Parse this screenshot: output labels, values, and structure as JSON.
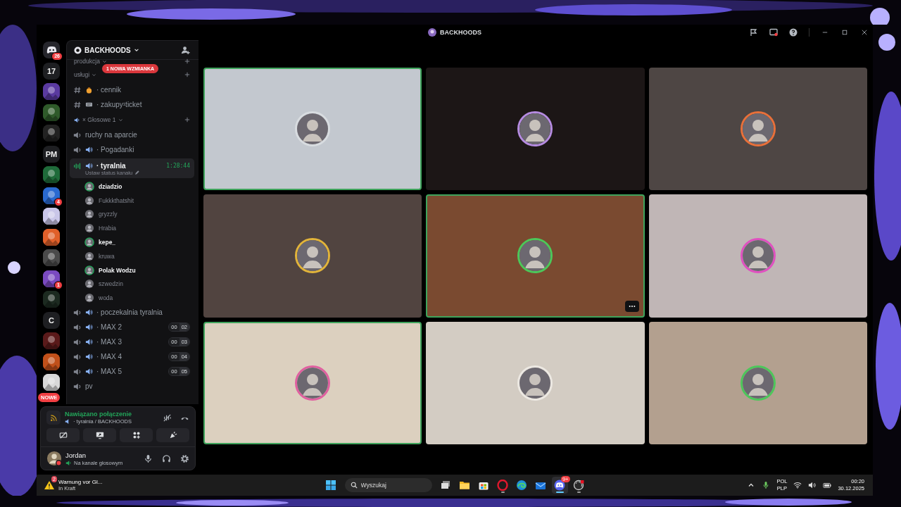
{
  "window": {
    "title": "BACKHOODS"
  },
  "servers": [
    {
      "kind": "home",
      "badge": "26"
    },
    {
      "kind": "text",
      "label": "17"
    },
    {
      "kind": "picture",
      "color": "#5a3aa0"
    },
    {
      "kind": "picture",
      "color": "#2f5a2a"
    },
    {
      "kind": "picture",
      "color": "#222222"
    },
    {
      "kind": "text",
      "label": "PM"
    },
    {
      "kind": "picture",
      "color": "#1f6b3a"
    },
    {
      "kind": "picture",
      "color": "#2a6ad0",
      "badge": "4"
    },
    {
      "kind": "picture",
      "color": "#c9c6e8"
    },
    {
      "kind": "picture",
      "color": "#e0602a"
    },
    {
      "kind": "picture",
      "color": "#4a4a4a"
    },
    {
      "kind": "picture",
      "color": "#7a4ac0",
      "badge": "1"
    },
    {
      "kind": "picture",
      "color": "#1c2a20"
    },
    {
      "kind": "text",
      "label": "C"
    },
    {
      "kind": "picture",
      "color": "#5a1a1a"
    },
    {
      "kind": "picture",
      "color": "#c0501a"
    },
    {
      "kind": "picture",
      "color": "#d8d8d8"
    }
  ],
  "new_pill": "NOWE",
  "server": {
    "name": "BACKHOODS",
    "mention_pill": "1 NOWA WZMIANKA"
  },
  "channels": [
    {
      "kind": "category",
      "label": "produkcja",
      "add": true
    },
    {
      "kind": "category",
      "label": "usługi",
      "add": true
    },
    {
      "kind": "text",
      "label": "· cennik",
      "emoji": {
        "kind": "bag"
      }
    },
    {
      "kind": "text",
      "label": "· zakupy¹ticket",
      "emoji": {
        "kind": "ticket"
      }
    },
    {
      "kind": "voice_category",
      "label": "× Głosowe 1",
      "add": true
    },
    {
      "kind": "voice",
      "label": "ruchy na aparcie",
      "emoji": false,
      "selected": false
    },
    {
      "kind": "voice",
      "label": "· Pogadanki",
      "emoji": true,
      "selected": false
    },
    {
      "kind": "voice",
      "label": "· tyralnia",
      "emoji": true,
      "selected": true,
      "timer": "1:28:44",
      "status": "Ustaw status kanału",
      "members": [
        {
          "name": "dziadzio",
          "speaking": true
        },
        {
          "name": "Fukkkthatshit",
          "speaking": false
        },
        {
          "name": "gryzzly",
          "speaking": false
        },
        {
          "name": "Hrabia",
          "speaking": false
        },
        {
          "name": "kepe_",
          "speaking": true
        },
        {
          "name": "kruwa",
          "speaking": false
        },
        {
          "name": "Polak Wodzu",
          "speaking": true
        },
        {
          "name": "szwedzin",
          "speaking": false
        },
        {
          "name": "woda",
          "speaking": false
        }
      ]
    },
    {
      "kind": "voice",
      "label": "· poczekalnia tyralnia",
      "emoji": true,
      "selected": false
    },
    {
      "kind": "voice",
      "label": "· MAX 2",
      "emoji": true,
      "selected": false,
      "count": "00",
      "limit": "02"
    },
    {
      "kind": "voice",
      "label": "· MAX 3",
      "emoji": true,
      "selected": false,
      "count": "00",
      "limit": "03"
    },
    {
      "kind": "voice",
      "label": "· MAX 4",
      "emoji": true,
      "selected": false,
      "count": "00",
      "limit": "04"
    },
    {
      "kind": "voice",
      "label": "· MAX 5",
      "emoji": true,
      "selected": false,
      "count": "00",
      "limit": "05"
    },
    {
      "kind": "voice",
      "label": "pv",
      "emoji": false,
      "selected": false
    }
  ],
  "connection": {
    "status": "Nawiązano połączenie",
    "channel": "· tyralnia / BACKHOODS"
  },
  "user": {
    "name": "Jordan",
    "status": "Na kanale głosowym"
  },
  "videos": [
    {
      "color": "#c3c8cf",
      "avatar": {
        "color": "#d8dce0"
      },
      "speaking": true,
      "menu": false
    },
    {
      "color": "#1c1616",
      "avatar": {
        "color": "#b58be0"
      },
      "speaking": false,
      "menu": false
    },
    {
      "color": "#4e4644",
      "avatar": {
        "color": "#e8703a"
      },
      "speaking": false,
      "menu": false
    },
    {
      "color": "#514440",
      "avatar": {
        "color": "#e2b43a"
      },
      "speaking": false,
      "menu": false
    },
    {
      "color": "#7a4a30",
      "avatar": {
        "color": "#4cc75a"
      },
      "speaking": true,
      "menu": true
    },
    {
      "color": "#c0b6b6",
      "avatar": {
        "color": "#e050c0"
      },
      "speaking": false,
      "menu": false
    },
    {
      "color": "#dcd0bf",
      "avatar": {
        "color": "#e060a0"
      },
      "speaking": true,
      "menu": false
    },
    {
      "color": "#d3ccc3",
      "avatar": {
        "color": "#ece8e2"
      },
      "speaking": false,
      "menu": false
    },
    {
      "color": "#b3a08f",
      "avatar": {
        "color": "#4cc75a"
      },
      "speaking": false,
      "menu": false
    }
  ],
  "taskbar": {
    "weather": {
      "title": "Warnung vor Gl...",
      "subtitle": "In Kraft",
      "badge": "2"
    },
    "search": {
      "placeholder": "Wyszukaj"
    },
    "apps": [
      {
        "kind": "taskview",
        "running": false,
        "active": false
      },
      {
        "kind": "folder",
        "running": false,
        "active": false
      },
      {
        "kind": "store",
        "running": false,
        "active": false
      },
      {
        "kind": "ring",
        "running": true,
        "active": false
      },
      {
        "kind": "swirl",
        "running": false,
        "active": false
      },
      {
        "kind": "mail",
        "running": false,
        "active": false
      },
      {
        "kind": "chat",
        "running": true,
        "active": true,
        "badge": "9+"
      },
      {
        "kind": "record",
        "running": true,
        "active": false
      }
    ],
    "tray": {
      "language": "POL",
      "layout": "PLP",
      "time": "00:20",
      "date": "30.12.2025"
    }
  }
}
